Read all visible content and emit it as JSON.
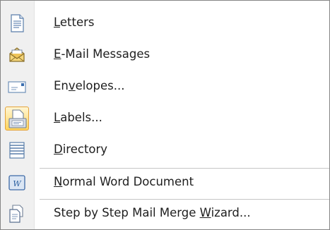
{
  "menu": {
    "items": [
      {
        "pre": "",
        "key": "L",
        "post": "etters",
        "icon": "letter-icon"
      },
      {
        "pre": "",
        "key": "E",
        "post": "-Mail Messages",
        "icon": "email-icon"
      },
      {
        "pre": "En",
        "key": "v",
        "post": "elopes...",
        "icon": "envelope-icon"
      },
      {
        "pre": "",
        "key": "L",
        "post": "abels...",
        "icon": "labels-icon",
        "selected": true
      },
      {
        "pre": "",
        "key": "D",
        "post": "irectory",
        "icon": "directory-icon"
      },
      {
        "pre": "",
        "key": "N",
        "post": "ormal Word Document",
        "icon": "word-document-icon"
      },
      {
        "pre": "Step by Step Mail Merge ",
        "key": "W",
        "post": "izard...",
        "icon": "wizard-icon"
      }
    ]
  }
}
